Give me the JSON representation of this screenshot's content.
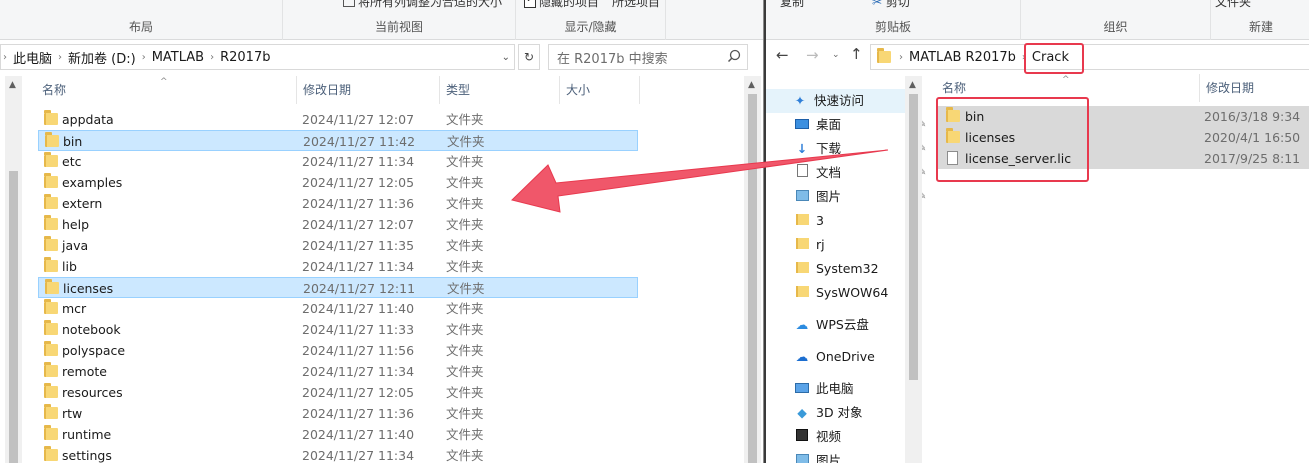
{
  "left": {
    "ribbon": {
      "groups": [
        "布局",
        "当前视图",
        "显示/隐藏"
      ],
      "top_texts": [
        "将所有列调整为合适的大小",
        "隐藏的项目",
        "所选项目"
      ]
    },
    "breadcrumb": [
      "此电脑",
      "新加卷 (D:)",
      "MATLAB",
      "R2017b"
    ],
    "search_placeholder": "在 R2017b 中搜索",
    "columns": [
      "名称",
      "修改日期",
      "类型",
      "大小"
    ],
    "rows": [
      {
        "name": "appdata",
        "date": "2024/11/27 12:07",
        "type": "文件夹",
        "selected": false
      },
      {
        "name": "bin",
        "date": "2024/11/27 11:42",
        "type": "文件夹",
        "selected": true
      },
      {
        "name": "etc",
        "date": "2024/11/27 11:34",
        "type": "文件夹",
        "selected": false
      },
      {
        "name": "examples",
        "date": "2024/11/27 12:05",
        "type": "文件夹",
        "selected": false
      },
      {
        "name": "extern",
        "date": "2024/11/27 11:36",
        "type": "文件夹",
        "selected": false
      },
      {
        "name": "help",
        "date": "2024/11/27 12:07",
        "type": "文件夹",
        "selected": false
      },
      {
        "name": "java",
        "date": "2024/11/27 11:35",
        "type": "文件夹",
        "selected": false
      },
      {
        "name": "lib",
        "date": "2024/11/27 11:34",
        "type": "文件夹",
        "selected": false
      },
      {
        "name": "licenses",
        "date": "2024/11/27 12:11",
        "type": "文件夹",
        "selected": true
      },
      {
        "name": "mcr",
        "date": "2024/11/27 11:40",
        "type": "文件夹",
        "selected": false
      },
      {
        "name": "notebook",
        "date": "2024/11/27 11:33",
        "type": "文件夹",
        "selected": false
      },
      {
        "name": "polyspace",
        "date": "2024/11/27 11:56",
        "type": "文件夹",
        "selected": false
      },
      {
        "name": "remote",
        "date": "2024/11/27 11:34",
        "type": "文件夹",
        "selected": false
      },
      {
        "name": "resources",
        "date": "2024/11/27 12:05",
        "type": "文件夹",
        "selected": false
      },
      {
        "name": "rtw",
        "date": "2024/11/27 11:36",
        "type": "文件夹",
        "selected": false
      },
      {
        "name": "runtime",
        "date": "2024/11/27 11:40",
        "type": "文件夹",
        "selected": false
      },
      {
        "name": "settings",
        "date": "2024/11/27 11:34",
        "type": "文件夹",
        "selected": false
      }
    ]
  },
  "right": {
    "ribbon": {
      "groups": [
        "剪贴板",
        "组织",
        "新建"
      ],
      "top_texts": [
        "复制",
        "剪切",
        "文件夹"
      ]
    },
    "breadcrumb": [
      "MATLAB R2017b",
      "Crack"
    ],
    "columns": [
      "名称",
      "修改日期"
    ],
    "nav": [
      {
        "label": "快速访问",
        "icon": "star-icon",
        "pinned": false
      },
      {
        "label": "桌面",
        "icon": "desktop-icon",
        "pinned": true
      },
      {
        "label": "下载",
        "icon": "download-icon",
        "pinned": true
      },
      {
        "label": "文档",
        "icon": "document-icon",
        "pinned": true
      },
      {
        "label": "图片",
        "icon": "picture-icon",
        "pinned": true
      },
      {
        "label": "3",
        "icon": "folder-icon",
        "pinned": false
      },
      {
        "label": "rj",
        "icon": "folder-icon",
        "pinned": false
      },
      {
        "label": "System32",
        "icon": "folder-icon",
        "pinned": false
      },
      {
        "label": "SysWOW64",
        "icon": "folder-icon",
        "pinned": false
      },
      {
        "label": "WPS云盘",
        "icon": "cloud-icon",
        "pinned": false
      },
      {
        "label": "OneDrive",
        "icon": "onedrive-icon",
        "pinned": false
      },
      {
        "label": "此电脑",
        "icon": "computer-icon",
        "pinned": false
      },
      {
        "label": "3D 对象",
        "icon": "3d-objects-icon",
        "pinned": false
      },
      {
        "label": "视频",
        "icon": "video-icon",
        "pinned": false
      },
      {
        "label": "图片",
        "icon": "picture-icon",
        "pinned": false
      }
    ],
    "rows": [
      {
        "name": "bin",
        "date": "2016/3/18 9:34",
        "kind": "folder"
      },
      {
        "name": "licenses",
        "date": "2020/4/1 16:50",
        "kind": "folder"
      },
      {
        "name": "license_server.lic",
        "date": "2017/9/25 8:11",
        "kind": "file"
      }
    ]
  },
  "colors": {
    "annotation": "#e8394e",
    "selection": "#cce8ff",
    "folder": "#f8d775"
  }
}
